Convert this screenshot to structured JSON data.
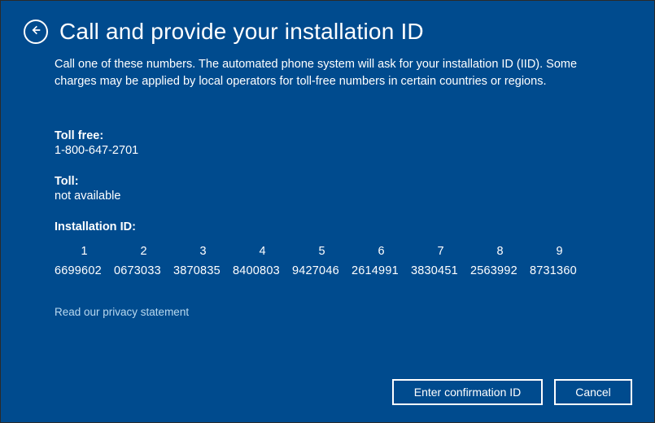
{
  "title": "Call and provide your installation ID",
  "description": "Call one of these numbers. The automated phone system will ask for your installation ID (IID). Some charges may be applied by local operators for toll-free numbers in certain countries or regions.",
  "tollFree": {
    "label": "Toll free:",
    "value": "1-800-647-2701"
  },
  "toll": {
    "label": "Toll:",
    "value": "not available"
  },
  "installationId": {
    "label": "Installation ID:",
    "groups": [
      {
        "index": "1",
        "value": "6699602"
      },
      {
        "index": "2",
        "value": "0673033"
      },
      {
        "index": "3",
        "value": "3870835"
      },
      {
        "index": "4",
        "value": "8400803"
      },
      {
        "index": "5",
        "value": "9427046"
      },
      {
        "index": "6",
        "value": "2614991"
      },
      {
        "index": "7",
        "value": "3830451"
      },
      {
        "index": "8",
        "value": "2563992"
      },
      {
        "index": "9",
        "value": "8731360"
      }
    ]
  },
  "privacyLink": "Read our privacy statement",
  "buttons": {
    "primary": "Enter confirmation ID",
    "cancel": "Cancel"
  }
}
